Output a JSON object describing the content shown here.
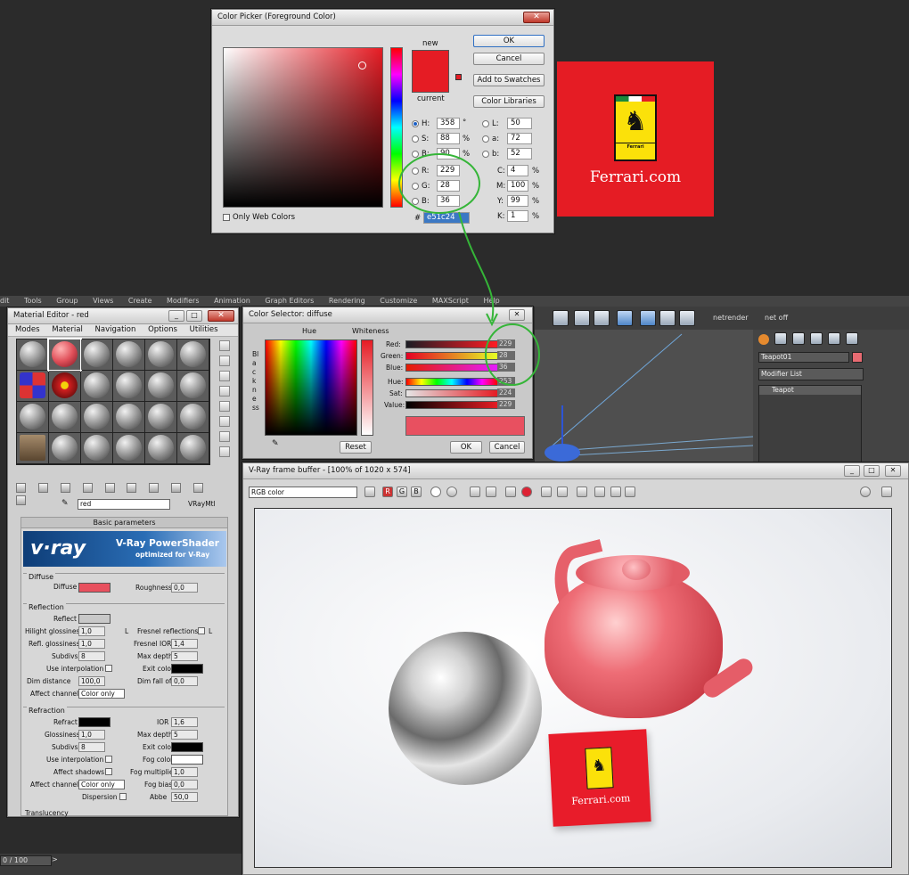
{
  "color_picker": {
    "title": "Color Picker (Foreground Color)",
    "new_label": "new",
    "current_label": "current",
    "buttons": {
      "ok": "OK",
      "cancel": "Cancel",
      "add_swatches": "Add to Swatches",
      "libraries": "Color Libraries"
    },
    "fields": {
      "H": "358",
      "S": "88",
      "B": "90",
      "R": "229",
      "G": "28",
      "B2": "36",
      "L": "50",
      "a": "72",
      "b": "52",
      "C": "4",
      "M": "100",
      "Y": "99",
      "K": "1",
      "hex": "e51c24"
    },
    "labels": {
      "H": "H:",
      "S": "S:",
      "B": "B:",
      "R": "R:",
      "G": "G:",
      "B2": "B:",
      "L": "L:",
      "a": "a:",
      "b": "b:",
      "C": "C:",
      "M": "M:",
      "Y": "Y:",
      "K": "K:",
      "hash": "#",
      "deg": "°",
      "pct": "%"
    },
    "only_web": "Only Web Colors",
    "colors": {
      "new": "#e51c24",
      "current": "#e51c24"
    }
  },
  "ferrari_card": {
    "text": "Ferrari.com",
    "badge": "Ferrari"
  },
  "max": {
    "menu": [
      "dit",
      "Tools",
      "Group",
      "Views",
      "Create",
      "Modifiers",
      "Animation",
      "Graph Editors",
      "Rendering",
      "Customize",
      "MAXScript",
      "Help"
    ],
    "toolbar_text": {
      "netrender": "netrender",
      "netoff": "net off"
    },
    "object_name": "Teapot01",
    "modifier_list": "Modifier List",
    "stack_item": "Teapot",
    "timeline": "0 / 100"
  },
  "material_editor": {
    "title": "Material Editor - red",
    "menu": [
      "Modes",
      "Material",
      "Navigation",
      "Options",
      "Utilities"
    ],
    "material_name": "red",
    "material_type": "VRayMtl",
    "basic_params": "Basic parameters",
    "vray_logo": "v·ray",
    "vray_title": "V-Ray PowerShader",
    "vray_sub": "optimized for V-Ray",
    "diffuse": {
      "group": "Diffuse",
      "label": "Diffuse",
      "roughness_label": "Roughness",
      "roughness": "0,0",
      "color": "#e8505e"
    },
    "reflection": {
      "group": "Reflection",
      "reflect": "Reflect",
      "hilight_gloss": "Hilight glossiness",
      "hilight_gloss_val": "1,0",
      "hilight_L": "L",
      "fresnel": "Fresnel reflections",
      "fresnel_L": "L",
      "refl_gloss": "Refl. glossiness",
      "refl_gloss_val": "1,0",
      "fresnel_ior": "Fresnel IOR",
      "fresnel_ior_val": "1,4",
      "subdivs": "Subdivs",
      "subdivs_val": "8",
      "max_depth": "Max depth",
      "max_depth_val": "5",
      "use_interp": "Use interpolation",
      "exit_color": "Exit color",
      "dim_distance": "Dim distance",
      "dim_distance_val": "100,0",
      "dim_falloff": "Dim fall off",
      "dim_falloff_val": "0,0",
      "affect_channels": "Affect channels",
      "affect_val": "Color only"
    },
    "refraction": {
      "group": "Refraction",
      "refract": "Refract",
      "ior": "IOR",
      "ior_val": "1,6",
      "glossiness": "Glossiness",
      "glossiness_val": "1,0",
      "max_depth": "Max depth",
      "max_depth_val": "5",
      "subdivs": "Subdivs",
      "subdivs_val": "8",
      "exit_color": "Exit color",
      "use_interp": "Use interpolation",
      "fog_color": "Fog color",
      "affect_shadows": "Affect shadows",
      "fog_mult": "Fog multiplier",
      "fog_mult_val": "1,0",
      "affect_channels": "Affect channels",
      "affect_val": "Color only",
      "fog_bias": "Fog bias",
      "fog_bias_val": "0,0",
      "dispersion": "Dispersion",
      "abbe": "Abbe",
      "abbe_val": "50,0"
    },
    "translucency": "Translucency"
  },
  "color_selector": {
    "title": "Color Selector: diffuse",
    "hue": "Hue",
    "whiteness": "Whiteness",
    "blackness": "Blackness",
    "rows": [
      {
        "label": "Red:",
        "value": "229"
      },
      {
        "label": "Green:",
        "value": "28"
      },
      {
        "label": "Blue:",
        "value": "36"
      },
      {
        "label": "Hue:",
        "value": "253"
      },
      {
        "label": "Sat:",
        "value": "224"
      },
      {
        "label": "Value:",
        "value": "229"
      }
    ],
    "reset": "Reset",
    "ok": "OK",
    "cancel": "Cancel"
  },
  "vfb": {
    "title": "V-Ray frame buffer - [100% of 1020 x 574]",
    "channel": "RGB color",
    "ch_R": "R",
    "ch_G": "G",
    "ch_B": "B",
    "card_text": "Ferrari.com"
  }
}
